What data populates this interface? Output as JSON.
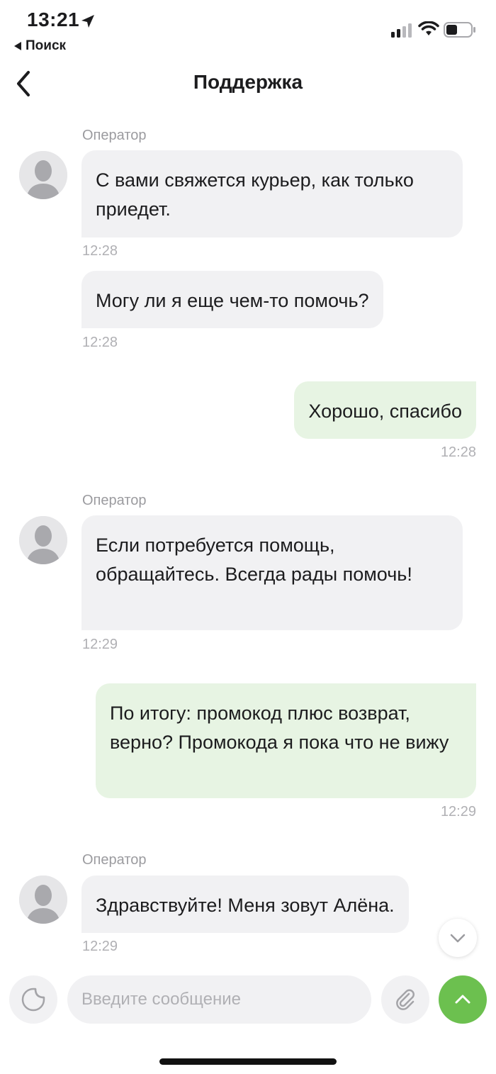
{
  "status_bar": {
    "time": "13:21",
    "back_app_label": "Поиск"
  },
  "header": {
    "title": "Поддержка"
  },
  "messages": [
    {
      "sender": "Оператор",
      "direction": "in",
      "text": "С вами свяжется курьер, как только приедет.",
      "time": "12:28"
    },
    {
      "direction": "in",
      "text": "Могу ли я еще чем-то помочь?",
      "time": "12:28"
    },
    {
      "direction": "out",
      "text": "Хорошо, спасибо",
      "time": "12:28"
    },
    {
      "sender": "Оператор",
      "direction": "in",
      "text": "Если потребуется помощь, обращайтесь. Всегда рады помочь!",
      "time": "12:29"
    },
    {
      "direction": "out",
      "text": "По итогу: промокод плюс возврат, верно? Промокода я пока что не вижу",
      "time": "12:29"
    },
    {
      "sender": "Оператор",
      "direction": "in",
      "text": "Здравствуйте! Меня зовут Алёна.",
      "time": "12:29"
    }
  ],
  "composer": {
    "placeholder": "Введите сообщение",
    "value": ""
  },
  "icons": {
    "back": "chevron-left-icon",
    "sticker": "sticker-icon",
    "attach": "paperclip-icon",
    "send": "chevron-up-icon",
    "scroll_down": "chevron-down-icon"
  },
  "colors": {
    "incoming_bubble": "#f1f1f3",
    "outgoing_bubble": "#e7f4e3",
    "send_button": "#6cc04f",
    "timestamp": "#b0b0b4",
    "sender_label": "#9b9b9f"
  }
}
